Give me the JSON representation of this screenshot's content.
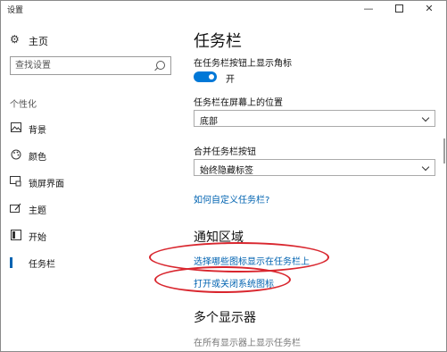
{
  "window": {
    "title": "设置",
    "minimize_symbol": "—",
    "close_symbol": "✕"
  },
  "sidebar": {
    "home_label": "主页",
    "home_icon": "gear-icon",
    "search_placeholder": "查找设置",
    "section_label": "个性化",
    "items": [
      {
        "label": "背景",
        "icon": "image-icon"
      },
      {
        "label": "颜色",
        "icon": "palette-icon"
      },
      {
        "label": "锁屏界面",
        "icon": "lock-screen-icon"
      },
      {
        "label": "主题",
        "icon": "theme-icon"
      },
      {
        "label": "开始",
        "icon": "start-icon"
      },
      {
        "label": "任务栏",
        "icon": "taskbar-icon",
        "active": true
      }
    ]
  },
  "main": {
    "title": "任务栏",
    "badge_toggle_label": "在任务栏按钮上显示角标",
    "badge_toggle_state": "开",
    "position_label": "任务栏在屏幕上的位置",
    "position_value": "底部",
    "combine_label": "合并任务栏按钮",
    "combine_value": "始终隐藏标签",
    "customize_link": "如何自定义任务栏?",
    "notification_title": "通知区域",
    "select_icons_link": "选择哪些图标显示在任务栏上",
    "system_icons_link": "打开或关闭系统图标",
    "multi_display_title": "多个显示器",
    "multi_display_option": "在所有显示器上显示任务栏"
  },
  "colors": {
    "accent": "#0078d7",
    "link": "#0063b1",
    "annotation": "#d9262e"
  }
}
